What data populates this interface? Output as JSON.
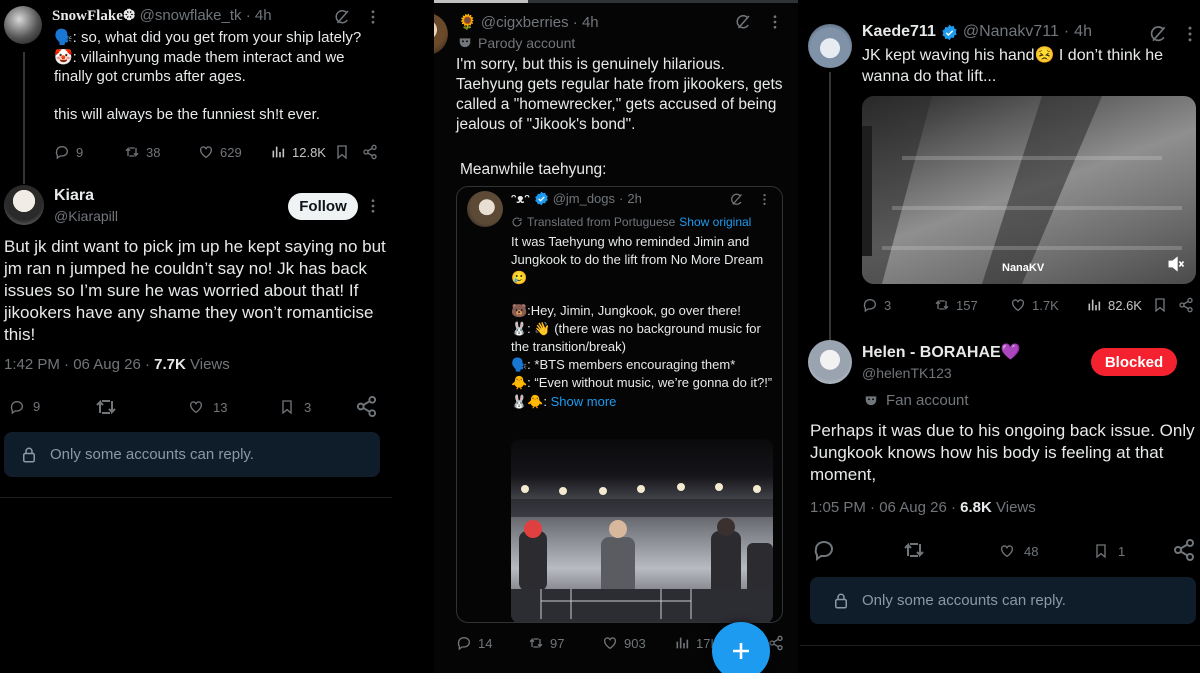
{
  "col1": {
    "tweet1": {
      "name": "SnowFlake❆",
      "handle": "@snowflake_tk",
      "dot": "·",
      "time": "4h",
      "line1": "🗣️: so, what did you get from your ship lately?",
      "line2": "🤡: villainhyung made them interact and we finally got crumbs after ages.",
      "line3": "this will always be the funniest sh!t ever.",
      "replies": "9",
      "retweets": "38",
      "likes": "629",
      "views": "12.8K"
    },
    "tweet2": {
      "name": "Kiara",
      "handle": "@Kiarapill",
      "follow_label": "Follow",
      "body": "But jk dint want to pick jm up he kept saying no but jm ran n jumped he couldn’t say no! Jk has back issues so I’m sure he was worried about that! If jikookers have any shame they won’t romanticise this!",
      "time": "1:42 PM",
      "date": "06 Aug 26",
      "dot": "·",
      "views_count": "7.7K",
      "views_label": "Views",
      "replies": "9",
      "likes": "13",
      "bookmarks": "3"
    },
    "reply_notice": "Only some accounts can reply."
  },
  "col2": {
    "tweet": {
      "prefix": "🌻",
      "handle": "@cigxberries",
      "dot": "·",
      "time": "4h",
      "parody_label": "Parody account",
      "body": "I'm sorry, but this is genuinely hilarious. Taehyung gets regular hate from jikookers, gets called a \"homewrecker,\" gets accused of being jealous of \"Jikook's bond\".",
      "meanwhile": "Meanwhile taehyung:",
      "replies": "14",
      "retweets": "97",
      "likes": "903",
      "views": "17K"
    },
    "quote": {
      "name": "ᵔᴥᵔ",
      "handle": "@jm_dogs",
      "dot": "·",
      "time": "2h",
      "translated_label": "Translated from Portuguese",
      "show_original": "Show original",
      "para1": "It was Taehyung who reminded Jimin and Jungkook to do the lift from No More Dream 🥲",
      "l1": "🐻:Hey, Jimin, Jungkook, go over there!",
      "l2": "🐰: 👋 (there was no background music for the transition/break)",
      "l3": "🗣️: *BTS members encouraging them*",
      "l4": "🐥: “Even without music, we’re gonna do it?!”",
      "l5": "🐰🐥:",
      "show_more": "Show more"
    }
  },
  "col3": {
    "tweet1": {
      "name": "Kaede711",
      "handle": "@Nanakv711",
      "dot": "·",
      "time": "4h",
      "body": "JK kept waving his hand😣 I don’t think he wanna do that lift...",
      "watermark": "NanaKV",
      "replies": "3",
      "retweets": "157",
      "likes": "1.7K",
      "views": "82.6K"
    },
    "tweet2": {
      "name": "Helen - BORAHAE💜",
      "handle": "@helenTK123",
      "blocked_label": "Blocked",
      "fan_label": "Fan account",
      "body": "Perhaps it was due to his ongoing back issue. Only Jungkook knows how his body is feeling at that moment,",
      "time": "1:05 PM",
      "date": "06 Aug 26",
      "dot": "·",
      "views_count": "6.8K",
      "views_label": "Views",
      "likes": "48",
      "bookmarks": "1"
    },
    "reply_notice": "Only some accounts can reply."
  },
  "colors": {
    "accent": "#1d9bf0",
    "muted": "#71767b",
    "blocked": "#f4212e",
    "reply_box": "#0f1d2b"
  },
  "icons": [
    "grok-icon",
    "more-icon",
    "reply-icon",
    "retweet-icon",
    "like-icon",
    "views-icon",
    "bookmark-icon",
    "share-icon",
    "lock-icon",
    "mute-icon",
    "plus-icon",
    "translate-icon",
    "parody-icon",
    "verified-icon"
  ]
}
